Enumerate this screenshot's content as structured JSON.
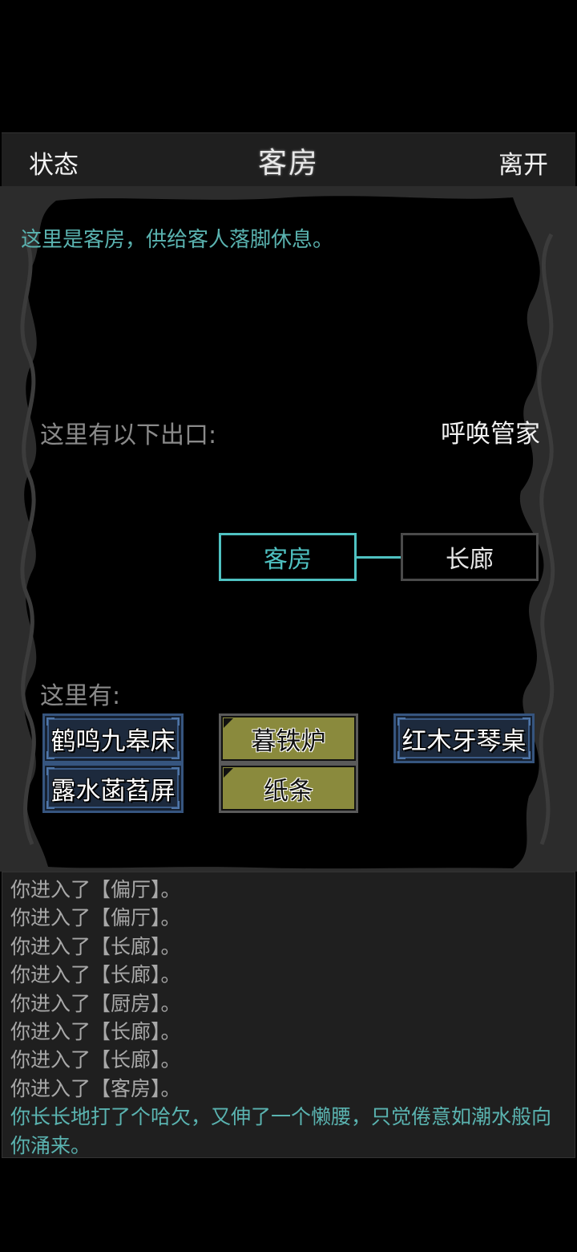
{
  "topbar": {
    "status_label": "状态",
    "title": "客房",
    "leave_label": "离开"
  },
  "scene": {
    "description": "这里是客房，供给客人落脚休息。",
    "exits_label": "这里有以下出口:",
    "summon_label": "呼唤管家",
    "map": {
      "current_room": "客房",
      "connected_room": "长廊"
    },
    "here_label": "这里有:",
    "npcs": [
      "鹤鸣九皋床",
      "露水菡萏屏",
      "红木牙琴桌"
    ],
    "objects": [
      "暮铁炉",
      "纸条"
    ]
  },
  "log": {
    "lines": [
      "你进入了【偏厅】。",
      "你进入了【偏厅】。",
      "你进入了【长廊】。",
      "你进入了【长廊】。",
      "你进入了【厨房】。",
      "你进入了【长廊】。",
      "你进入了【长廊】。",
      "你进入了【客房】。"
    ],
    "latest": "你长长地打了个哈欠，又伸了一个懒腰，只觉倦意如潮水般向你涌来。"
  },
  "colors": {
    "accent_teal": "#4fc2c2",
    "description_text": "#5ab3b0",
    "npc_frame": "#36557f",
    "object_fill": "#8a8a3d"
  }
}
